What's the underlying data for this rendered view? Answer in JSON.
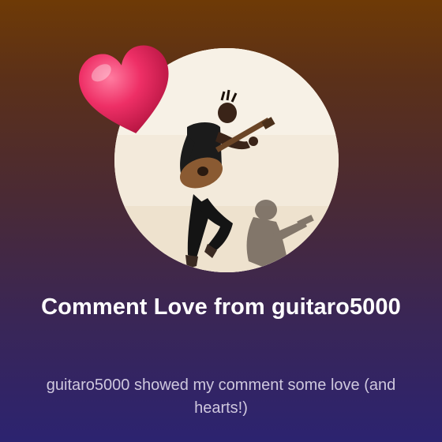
{
  "notification": {
    "title": "Comment Love from guitaro5000",
    "message": "guitaro5000 showed my comment some love (and hearts!)",
    "username": "guitaro5000"
  },
  "avatar": {
    "icon": "profile-photo-guitarist"
  },
  "heart": {
    "icon": "heart-icon",
    "color": "#e8265e"
  },
  "colors": {
    "background_top": "#6e3a06",
    "background_bottom": "#2c2370",
    "title_text": "#ffffff",
    "message_text": "#cfc8de"
  }
}
